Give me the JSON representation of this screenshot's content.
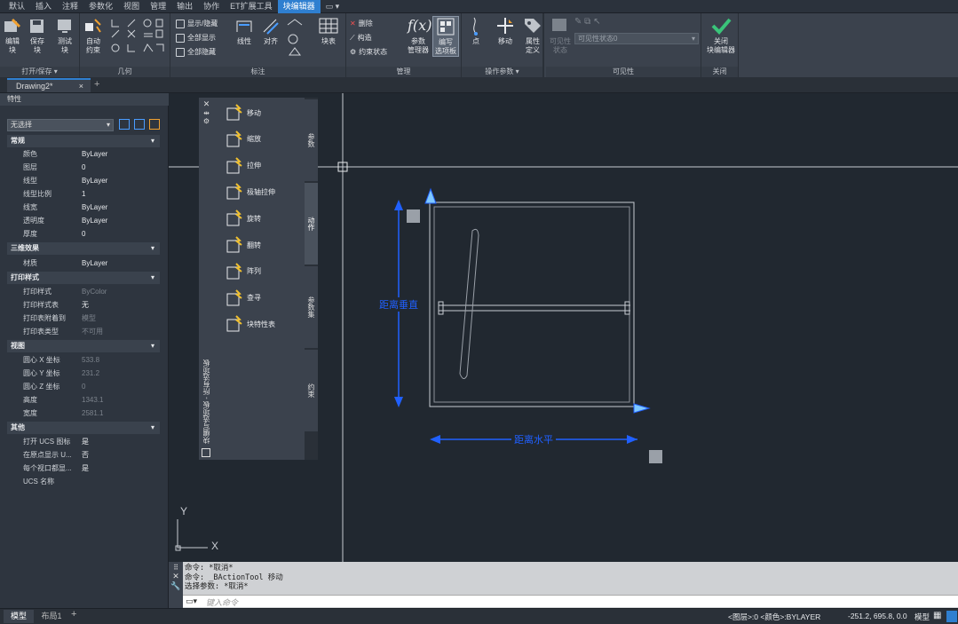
{
  "menu": {
    "tabs": [
      "默认",
      "插入",
      "注释",
      "参数化",
      "视图",
      "管理",
      "输出",
      "协作",
      "ET扩展工具",
      "块编辑器",
      "▭ ▾"
    ],
    "active_index": 9
  },
  "ribbon": {
    "groups": {
      "open_save": {
        "label": "打开/保存 ▾",
        "buttons": [
          "编辑\n块",
          "保存\n块",
          "测试\n块"
        ]
      },
      "geometry": {
        "label": "几何",
        "auto_constrain": "自动\n约束"
      },
      "dimension": {
        "label": "标注",
        "show_hide": "显示/隐藏",
        "show_all": "全部显示",
        "hide_all": "全部隐藏",
        "linear": "线性",
        "aligned": "对齐"
      },
      "manage": {
        "label": "管理",
        "block_table": "块表",
        "erase": "删除",
        "construct": "构造",
        "constraint_status": "约束状态",
        "param_manager": "参数\n管理器",
        "authoring_palettes": "编写\n选项板"
      },
      "action_params": {
        "label": "操作参数 ▾",
        "point": "点",
        "move": "移动"
      },
      "attribute": {
        "define": "属性\n定义"
      },
      "visibility": {
        "label": "可见性",
        "visibility_mode": "可见性\n状态",
        "state_select": "可见性状态0"
      },
      "close": {
        "label": "关闭",
        "close_editor": "关闭\n块编辑器"
      }
    }
  },
  "doc_tabs": {
    "active": "Drawing2*",
    "close": "×",
    "add": "+"
  },
  "properties": {
    "title": "特性",
    "selection": "无选择",
    "sections": {
      "general": "常规",
      "three_d": "三维效果",
      "plot": "打印样式",
      "view": "视图",
      "misc": "其他"
    },
    "general_rows": [
      {
        "k": "颜色",
        "v": "ByLayer"
      },
      {
        "k": "图层",
        "v": "0"
      },
      {
        "k": "线型",
        "v": "ByLayer"
      },
      {
        "k": "线型比例",
        "v": "1"
      },
      {
        "k": "线宽",
        "v": "ByLayer"
      },
      {
        "k": "透明度",
        "v": "ByLayer"
      },
      {
        "k": "厚度",
        "v": "0"
      }
    ],
    "three_d_rows": [
      {
        "k": "材质",
        "v": "ByLayer"
      }
    ],
    "plot_rows": [
      {
        "k": "打印样式",
        "v": "ByColor"
      },
      {
        "k": "打印样式表",
        "v": "无"
      },
      {
        "k": "打印表附着到",
        "v": "模型"
      },
      {
        "k": "打印表类型",
        "v": "不可用"
      }
    ],
    "view_rows": [
      {
        "k": "圆心 X 坐标",
        "v": "533.8"
      },
      {
        "k": "圆心 Y 坐标",
        "v": "231.2"
      },
      {
        "k": "圆心 Z 坐标",
        "v": "0"
      },
      {
        "k": "高度",
        "v": "1343.1"
      },
      {
        "k": "宽度",
        "v": "2581.1"
      }
    ],
    "misc_rows": [
      {
        "k": "打开 UCS 图标",
        "v": "是"
      },
      {
        "k": "在原点显示 U...",
        "v": "否"
      },
      {
        "k": "每个视口都显...",
        "v": "是"
      },
      {
        "k": "UCS 名称",
        "v": ""
      }
    ]
  },
  "palette": {
    "title": "块编写选项板 - 所有选项板",
    "tabs": [
      "参数",
      "动作",
      "参数集",
      "约束"
    ],
    "items": [
      "移动",
      "缩放",
      "拉伸",
      "极轴拉伸",
      "旋转",
      "翻转",
      "阵列",
      "查寻",
      "块特性表"
    ]
  },
  "drawing": {
    "dim_vertical": "距离垂直",
    "dim_horizontal": "距离水平",
    "ucs_x": "X",
    "ucs_y": "Y"
  },
  "command": {
    "history": [
      "命令: *取消*",
      "命令: _BActionTool 移动",
      "选择参数: *取消*"
    ],
    "placeholder": "键入命令"
  },
  "layout_tabs": [
    "模型",
    "布局1",
    "+"
  ],
  "status": {
    "layer_info": "<图层>:0 <颜色>:BYLAYER",
    "coords": "-251.2, 695.8, 0.0",
    "mode": "模型"
  },
  "colors": {
    "accent": "#2f7fd0",
    "dimension": "#2060ff",
    "canvas": "#212830"
  }
}
